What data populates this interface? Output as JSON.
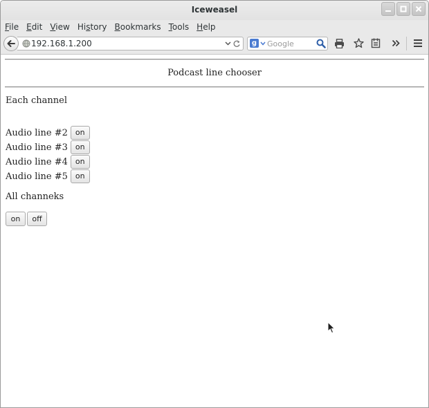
{
  "window": {
    "title": "Iceweasel"
  },
  "menubar": {
    "items": [
      {
        "pre": "",
        "u": "F",
        "post": "ile"
      },
      {
        "pre": "",
        "u": "E",
        "post": "dit"
      },
      {
        "pre": "",
        "u": "V",
        "post": "iew"
      },
      {
        "pre": "Hi",
        "u": "s",
        "post": "tory"
      },
      {
        "pre": "",
        "u": "B",
        "post": "ookmarks"
      },
      {
        "pre": "",
        "u": "T",
        "post": "ools"
      },
      {
        "pre": "",
        "u": "H",
        "post": "elp"
      }
    ]
  },
  "navbar": {
    "url": "192.168.1.200",
    "search_placeholder": "Google"
  },
  "page": {
    "title": "Podcast line chooser",
    "section_each": "Each channel",
    "lines": [
      {
        "label": "Audio line #2",
        "button": "on"
      },
      {
        "label": "Audio line #3",
        "button": "on"
      },
      {
        "label": "Audio line #4",
        "button": "on"
      },
      {
        "label": "Audio line #5",
        "button": "on"
      }
    ],
    "section_all": "All channeks",
    "all_on": "on",
    "all_off": "off"
  },
  "colors": {
    "accent": "#4a7bd1",
    "titlebar": "#e6e6e6",
    "text": "#222222"
  }
}
